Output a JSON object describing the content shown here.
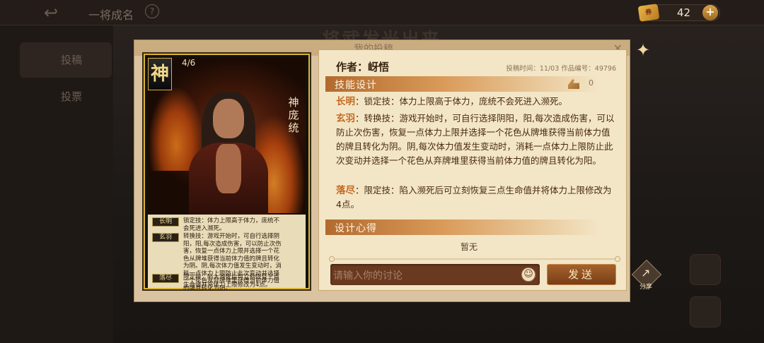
{
  "background": {
    "title": "一将成名",
    "help_glyph": "?",
    "back_glyph": "↩",
    "tabs": [
      {
        "label": "投稿"
      },
      {
        "label": "投票"
      }
    ],
    "heading": "将武发光出来"
  },
  "currency": {
    "value": "42",
    "plus_glyph": "+"
  },
  "dialog": {
    "title": "我的投稿",
    "close_glyph": "✕"
  },
  "card": {
    "badge": "神",
    "hp": "4/6",
    "name": "神庞统",
    "skills": [
      {
        "tag": "长明",
        "text": "锁定技：体力上限高于体力，庞统不会死进入濒死。"
      },
      {
        "tag": "玄羽",
        "text": "转换技：游戏开始时，可自行选择阴阳，阳,每次造成伤害，可以防止次伤害，恢复一点体力上限并选择一个花色从牌堆获得当前体力值的牌且转化为阴。阴,每次体力值发生变动时，消耗一点体力上限防止此次变动并选择一个花色从弃牌堆里获得当前体力值的牌且转化为阳。"
      },
      {
        "tag": "落尽",
        "text": "限定技：陷入濒死后可立刻恢复三点生命值并将体力上限修改为4点。"
      }
    ]
  },
  "panel": {
    "author_label": "作者：",
    "author_name": "岈悟",
    "meta": "投稿时间：11/03  作品编号：49796",
    "skill_section_title": "技能设计",
    "like_count": "0",
    "skills": [
      {
        "name": "长明",
        "text": "：锁定技：体力上限高于体力，庞统不会死进入濒死。"
      },
      {
        "name": "玄羽",
        "text": "：转换技：游戏开始时，可自行选择阴阳，阳,每次造成伤害，可以防止次伤害，恢复一点体力上限并选择一个花色从牌堆获得当前体力值的牌且转化为阴。阴,每次体力值发生变动时，消耗一点体力上限防止此次变动并选择一个花色从弃牌堆里获得当前体力值的牌且转化为阳。"
      },
      {
        "name": "落尽",
        "text": "：限定技：陷入濒死后可立刻恢复三点生命值并将体力上限修改为4点。"
      }
    ],
    "design_section_title": "设计心得",
    "design_note": "暂无",
    "input_placeholder": "请输入你的讨论",
    "emoji_glyph": "☺",
    "send_label": "发送"
  },
  "share": {
    "label": "分享",
    "arrow_glyph": "↗"
  },
  "colors": {
    "accent": "#c46a24",
    "section_bar": "#b26a2e",
    "card_border": "#d8b13a",
    "panel_bg": "#f3e6c6"
  }
}
